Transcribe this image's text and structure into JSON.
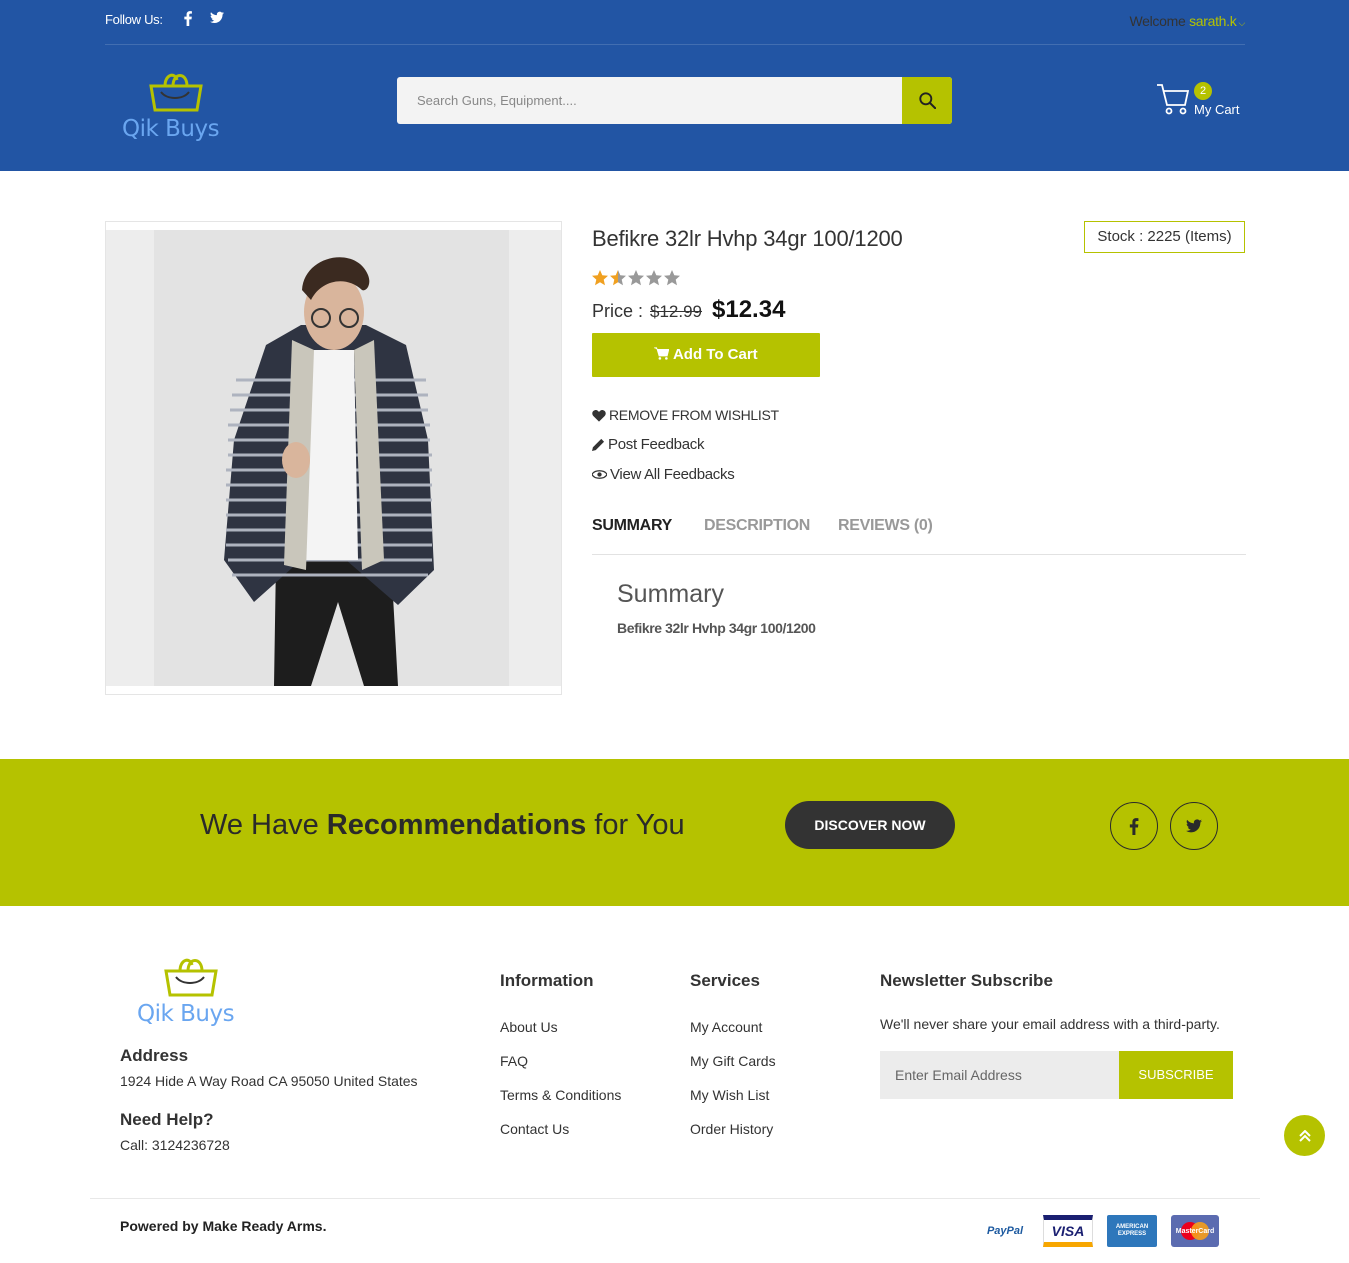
{
  "topbar": {
    "follow_label": "Follow Us:",
    "welcome_label": "Welcome ",
    "username": "sarath.k"
  },
  "logo": {
    "text": "Qik Buys"
  },
  "search": {
    "placeholder": "Search Guns, Equipment...."
  },
  "cart": {
    "count": "2",
    "label": "My Cart"
  },
  "product": {
    "title": "Befikre 32lr Hvhp 34gr 100/1200",
    "stock": "Stock : 2225 (Items)",
    "rating_stars_filled": 1.5,
    "rating_stars_total": 5,
    "price_label": "Price : ",
    "old_price": "$12.99",
    "new_price": "$12.34",
    "add_to_cart": "Add To Cart",
    "wishlist": "REMOVE FROM WISHLIST",
    "post_feedback": "Post Feedback",
    "view_feedbacks": "View All Feedbacks"
  },
  "tabs": [
    {
      "label": "SUMMARY",
      "active": true
    },
    {
      "label": "DESCRIPTION",
      "active": false
    },
    {
      "label": "REVIEWS (0)",
      "active": false
    }
  ],
  "summary": {
    "heading": "Summary",
    "text": "Befikre 32lr Hvhp 34gr 100/1200"
  },
  "banner": {
    "text_pre": "We Have ",
    "text_bold": "Recommendations",
    "text_post": " for You",
    "button": "DISCOVER NOW"
  },
  "footer": {
    "address_title": "Address",
    "address": "1924 Hide A Way Road CA 95050 United States",
    "help_title": "Need Help?",
    "call": "Call: 3124236728",
    "information": {
      "title": "Information",
      "links": [
        "About Us",
        "FAQ",
        "Terms & Conditions",
        "Contact Us"
      ]
    },
    "services": {
      "title": "Services",
      "links": [
        "My Account",
        "My Gift Cards",
        "My Wish List",
        "Order History"
      ]
    },
    "newsletter": {
      "title": "Newsletter Subscribe",
      "note": "We'll never share your email address with a third-party.",
      "placeholder": "Enter Email Address",
      "button": "SUBSCRIBE"
    },
    "powered": "Powered by Make Ready Arms.",
    "payments": [
      "PayPal",
      "VISA",
      "AMERICAN EXPRESS",
      "MasterCard"
    ]
  },
  "colors": {
    "header_blue": "#2255a4",
    "accent_lime": "#b5c200",
    "dark": "#333333"
  }
}
